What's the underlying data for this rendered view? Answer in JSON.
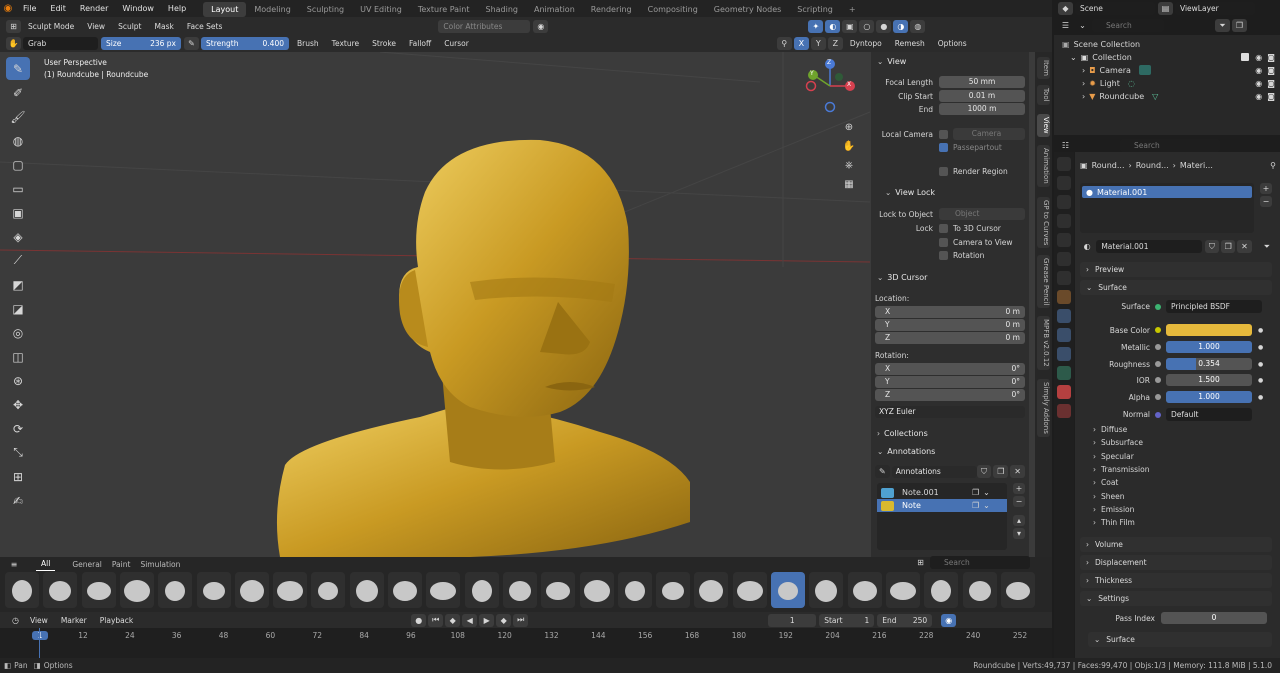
{
  "menu": [
    "File",
    "Edit",
    "Render",
    "Window",
    "Help"
  ],
  "workspaces": [
    "Layout",
    "Modeling",
    "Sculpting",
    "UV Editing",
    "Texture Paint",
    "Shading",
    "Animation",
    "Rendering",
    "Compositing",
    "Geometry Nodes",
    "Scripting",
    "+"
  ],
  "active_workspace": "Layout",
  "scene": {
    "label": "Scene",
    "view_layer": "ViewLayer"
  },
  "header": {
    "mode": "Sculpt Mode",
    "view": "View",
    "sculpt": "Sculpt",
    "mask": "Mask",
    "face_sets": "Face Sets",
    "color_attributes": "Color Attributes"
  },
  "tool_settings": {
    "brush": "Grab",
    "size_label": "Size",
    "size_value": "236 px",
    "strength_label": "Strength",
    "strength_value": "0.400",
    "brush_menu": "Brush",
    "texture": "Texture",
    "stroke": "Stroke",
    "falloff": "Falloff",
    "cursor": "Cursor",
    "axes": [
      "X",
      "Y",
      "Z"
    ],
    "dyntopo": "Dyntopo",
    "remesh": "Remesh",
    "options": "Options"
  },
  "viewport": {
    "title": "User Perspective",
    "object": "(1) Roundcube | Roundcube"
  },
  "gizmo": {
    "x": "X",
    "y": "Y",
    "z": "Z"
  },
  "npanel": {
    "view_title": "View",
    "focal_length_label": "Focal Length",
    "focal_length": "50 mm",
    "clip_start_label": "Clip Start",
    "clip_start": "0.01 m",
    "end_label": "End",
    "end": "1000 m",
    "local_camera_label": "Local Camera",
    "local_camera": "Camera",
    "passepartout": "Passepartout",
    "render_region": "Render Region",
    "view_lock_title": "View Lock",
    "lock_to_object_label": "Lock to Object",
    "lock_to_object": "Object",
    "lock_label": "Lock",
    "to_3d_cursor": "To 3D Cursor",
    "camera_to_view": "Camera to View",
    "rotation_lock": "Rotation",
    "cursor_title": "3D Cursor",
    "location_label": "Location:",
    "loc": [
      {
        "axis": "X",
        "value": "0 m"
      },
      {
        "axis": "Y",
        "value": "0 m"
      },
      {
        "axis": "Z",
        "value": "0 m"
      }
    ],
    "rotation_label": "Rotation:",
    "rot": [
      {
        "axis": "X",
        "value": "0°"
      },
      {
        "axis": "Y",
        "value": "0°"
      },
      {
        "axis": "Z",
        "value": "0°"
      }
    ],
    "rotation_mode": "XYZ Euler",
    "collections_title": "Collections",
    "annotations_title": "Annotations",
    "annotations_name": "Annotations",
    "notes": [
      {
        "name": "Note.001",
        "color": "#4fa1d0"
      },
      {
        "name": "Note",
        "color": "#d8b92e"
      }
    ]
  },
  "vertical_tabs": [
    "Item",
    "Tool",
    "View",
    "Animation",
    "GP to Curves",
    "Grease Pencil",
    "MPFB v2.0.12",
    "Simply Addons"
  ],
  "brush_tabs": [
    "All",
    "General",
    "Paint",
    "Simulation"
  ],
  "timeline": {
    "playback_menu": [
      "View",
      "Marker",
      "Playback"
    ],
    "current_frame": "1",
    "start_label": "Start",
    "start": "1",
    "end_label": "End",
    "end": "250",
    "ticks": [
      "1",
      "12",
      "24",
      "36",
      "48",
      "60",
      "72",
      "84",
      "96",
      "108",
      "120",
      "132",
      "144",
      "156",
      "168",
      "180",
      "192",
      "204",
      "216",
      "228",
      "240",
      "252"
    ]
  },
  "status": {
    "left1": "Pan",
    "left2": "Options",
    "right": "Roundcube | Verts:49,737 | Faces:99,470 | Objs:1/3 | Memory: 111.8 MiB | 5.1.0"
  },
  "outliner": {
    "search_placeholder": "Search",
    "root": "Scene Collection",
    "items": [
      {
        "name": "Collection"
      },
      {
        "name": "Camera"
      },
      {
        "name": "Light"
      },
      {
        "name": "Roundcube"
      }
    ]
  },
  "properties": {
    "search_placeholder": "Search",
    "breadcrumb": [
      "Round...",
      "Round...",
      "Materi..."
    ],
    "slot": "Material.001",
    "material_name": "Material.001",
    "sections": {
      "preview": "Preview",
      "surface": "Surface",
      "volume": "Volume",
      "displacement": "Displacement",
      "thickness": "Thickness",
      "settings": "Settings"
    },
    "surface_label": "Surface",
    "surface_value": "Principled BSDF",
    "base_color_label": "Base Color",
    "base_color": "#e6b93c",
    "metallic_label": "Metallic",
    "metallic": "1.000",
    "roughness_label": "Roughness",
    "roughness": "0.354",
    "ior_label": "IOR",
    "ior": "1.500",
    "alpha_label": "Alpha",
    "alpha": "1.000",
    "normal_label": "Normal",
    "normal": "Default",
    "subpanels": [
      "Diffuse",
      "Subsurface",
      "Specular",
      "Transmission",
      "Coat",
      "Sheen",
      "Emission",
      "Thin Film"
    ],
    "pass_index_label": "Pass Index",
    "pass_index": "0",
    "surface_sub": "Surface"
  }
}
